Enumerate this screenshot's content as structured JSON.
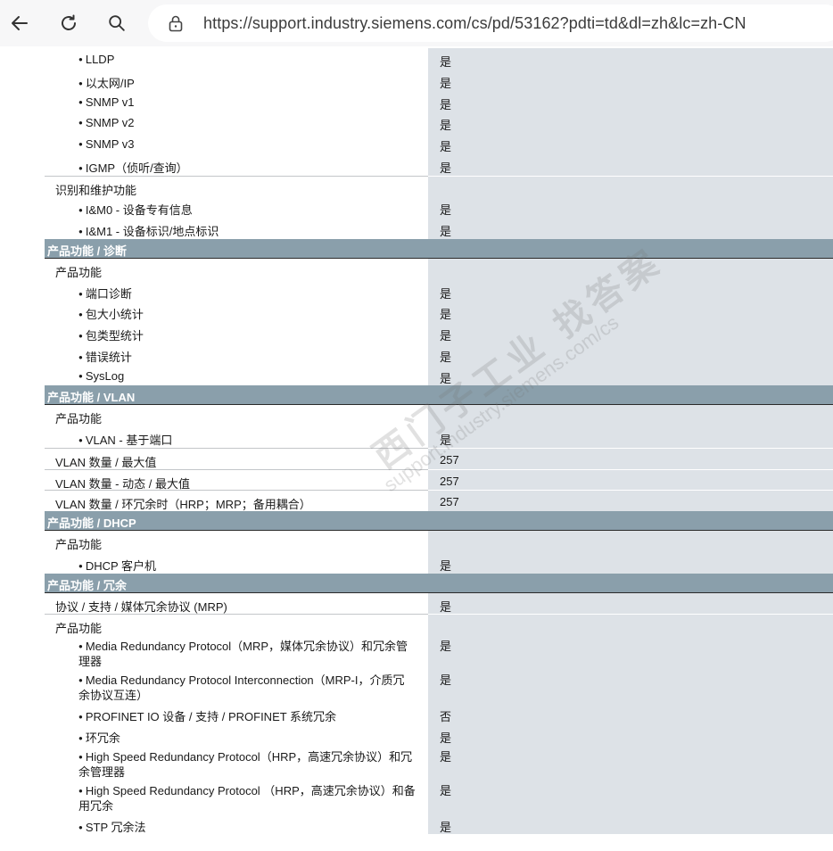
{
  "browser": {
    "url": "https://support.industry.siemens.com/cs/pd/53162?pdti=td&dl=zh&lc=zh-CN",
    "back_icon": "arrow-left",
    "reload_icon": "reload",
    "search_icon": "magnifier",
    "lock_icon": "lock"
  },
  "colors": {
    "section_header": "#8a9fab",
    "value_column": "#dde2e7"
  },
  "rows": [
    {
      "type": "item",
      "level": 2,
      "label": "LLDP",
      "value": "是"
    },
    {
      "type": "item",
      "level": 2,
      "label": "以太网/IP",
      "value": "是"
    },
    {
      "type": "item",
      "level": 2,
      "label": "SNMP v1",
      "value": "是"
    },
    {
      "type": "item",
      "level": 2,
      "label": "SNMP v2",
      "value": "是"
    },
    {
      "type": "item",
      "level": 2,
      "label": "SNMP v3",
      "value": "是"
    },
    {
      "type": "item",
      "level": 2,
      "label": "IGMP（侦听/查询）",
      "value": "是"
    },
    {
      "type": "item",
      "level": 1,
      "label": "识别和维护功能",
      "value": "",
      "border": true
    },
    {
      "type": "item",
      "level": 2,
      "label": "I&M0 - 设备专有信息",
      "value": "是"
    },
    {
      "type": "item",
      "level": 2,
      "label": "I&M1 - 设备标识/地点标识",
      "value": "是"
    },
    {
      "type": "section",
      "label": "产品功能 / 诊断"
    },
    {
      "type": "item",
      "level": 1,
      "label": "产品功能",
      "value": ""
    },
    {
      "type": "item",
      "level": 2,
      "label": "端口诊断",
      "value": "是"
    },
    {
      "type": "item",
      "level": 2,
      "label": "包大小统计",
      "value": "是"
    },
    {
      "type": "item",
      "level": 2,
      "label": "包类型统计",
      "value": "是"
    },
    {
      "type": "item",
      "level": 2,
      "label": "错误统计",
      "value": "是"
    },
    {
      "type": "item",
      "level": 2,
      "label": "SysLog",
      "value": "是"
    },
    {
      "type": "section",
      "label": "产品功能 / VLAN"
    },
    {
      "type": "item",
      "level": 1,
      "label": "产品功能",
      "value": ""
    },
    {
      "type": "item",
      "level": 2,
      "label": "VLAN - 基于端口",
      "value": "是"
    },
    {
      "type": "item",
      "level": 1,
      "label": "VLAN 数量 / 最大值",
      "value": "257",
      "border": true
    },
    {
      "type": "item",
      "level": 1,
      "label": "VLAN 数量 - 动态 / 最大值",
      "value": "257",
      "border": true
    },
    {
      "type": "item",
      "level": 1,
      "label": "VLAN 数量 / 环冗余时（HRP；MRP；备用耦合）",
      "value": "257",
      "border": true
    },
    {
      "type": "section",
      "label": "产品功能 / DHCP"
    },
    {
      "type": "item",
      "level": 1,
      "label": "产品功能",
      "value": ""
    },
    {
      "type": "item",
      "level": 2,
      "label": "DHCP 客户机",
      "value": "是"
    },
    {
      "type": "section",
      "label": "产品功能 / 冗余"
    },
    {
      "type": "item",
      "level": 1,
      "label": "协议 / 支持 / 媒体冗余协议 (MRP)",
      "value": "是"
    },
    {
      "type": "item",
      "level": 1,
      "label": "产品功能",
      "value": "",
      "border": true
    },
    {
      "type": "item",
      "level": 2,
      "label": "Media Redundancy Protocol（MRP，媒体冗余协议）和冗余管理器",
      "value": "是",
      "tall": true
    },
    {
      "type": "item",
      "level": 2,
      "label": "Media Redundancy Protocol Interconnection（MRP-I，介质冗余协议互连）",
      "value": "是",
      "tall": true
    },
    {
      "type": "item",
      "level": 2,
      "label": "PROFINET IO 设备 / 支持 / PROFINET 系统冗余",
      "value": "否"
    },
    {
      "type": "item",
      "level": 2,
      "label": "环冗余",
      "value": "是"
    },
    {
      "type": "item",
      "level": 2,
      "label": "High Speed Redundancy Protocol（HRP，高速冗余协议）和冗余管理器",
      "value": "是",
      "tall": true
    },
    {
      "type": "item",
      "level": 2,
      "label": "High Speed Redundancy Protocol （HRP，高速冗余协议）和备用冗余",
      "value": "是",
      "tall": true
    },
    {
      "type": "item",
      "level": 2,
      "label": "STP 冗余法",
      "value": "是"
    }
  ],
  "watermark": {
    "line1": "西门子工业 找答案",
    "line2": "support.industry.siemens.com/cs"
  }
}
